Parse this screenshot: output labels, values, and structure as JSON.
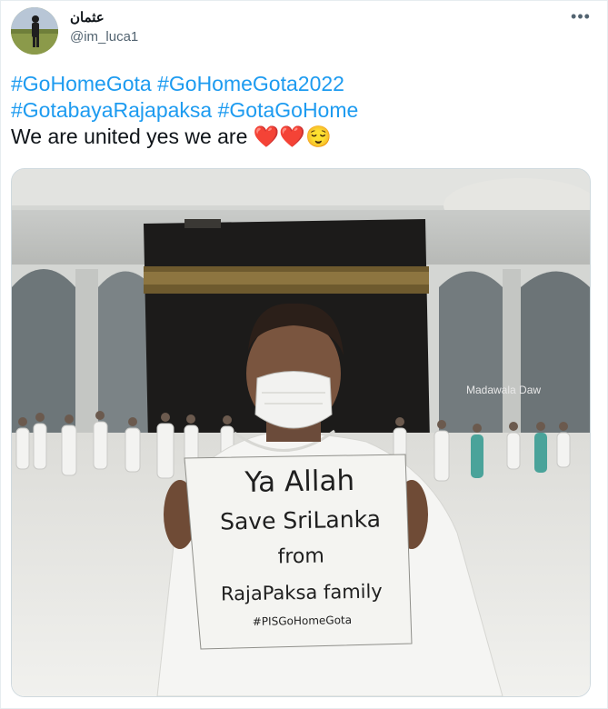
{
  "tweet": {
    "display_name": "عثمان",
    "handle": "@im_luca1",
    "more_icon": "three-dots-icon",
    "hashtags_line1": [
      "#GoHomeGota",
      "#GoHomeGota2022"
    ],
    "hashtags_line2": [
      "#GotabayaRajapaksa",
      "#GotaGoHome"
    ],
    "text": "We are united yes we are",
    "emojis": [
      "❤️",
      "❤️",
      "😌"
    ]
  },
  "photo": {
    "watermark": "Madawala Daw",
    "sign_lines": [
      "Ya Allah",
      "Save SriLanka",
      "from",
      "RajaPaksa family",
      "#PISGoHomeGota"
    ]
  },
  "colors": {
    "link": "#1d9bf0",
    "text": "#0f1419",
    "muted": "#536471",
    "border": "#cfd9de"
  }
}
